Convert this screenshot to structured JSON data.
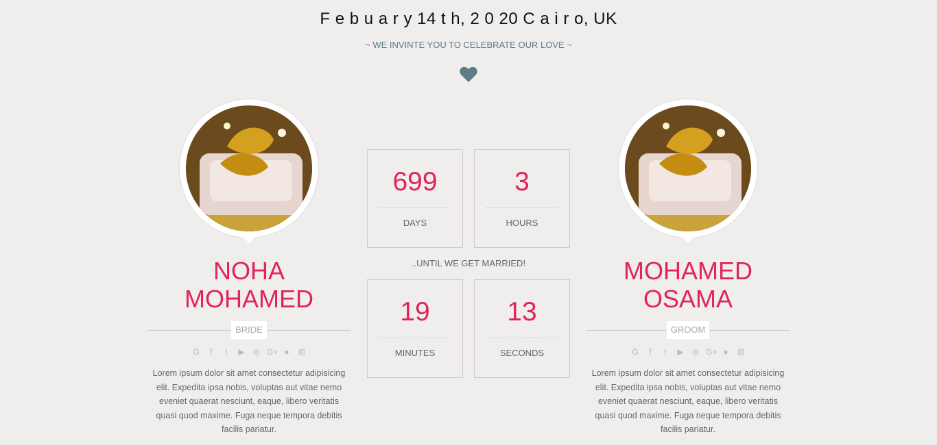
{
  "header": {
    "title": "F e b u a r y 14 t h, 2 0 20 C a i r o, UK",
    "subtitle": "~ WE INVINTE YOU TO CELEBRATE OUR LOVE ~",
    "heart_icon": "heart-icon",
    "heart_color": "#5e7b88"
  },
  "bride": {
    "name_line1": "NOHA",
    "name_line2": "MOHAMED",
    "role": "BRIDE",
    "bio": "Lorem ipsum dolor sit amet consectetur adipisicing elit. Expedita ipsa nobis, voluptas aut vitae nemo eveniet quaerat nesciunt, eaque, libero veritatis quasi quod maxime. Fuga neque tempora debitis facilis pariatur."
  },
  "groom": {
    "name_line1": "MOHAMED",
    "name_line2": "OSAMA",
    "role": "GROOM",
    "bio": "Lorem ipsum dolor sit amet consectetur adipisicing elit. Expedita ipsa nobis, voluptas aut vitae nemo eveniet quaerat nesciunt, eaque, libero veritatis quasi quod maxime. Fuga neque tempora debitis facilis pariatur."
  },
  "socials": [
    "google-icon",
    "facebook-icon",
    "twitter-icon",
    "youtube-icon",
    "instagram-icon",
    "google-plus-icon",
    "messenger-icon",
    "share-icon"
  ],
  "countdown": {
    "days": {
      "value": "699",
      "label": "DAYS"
    },
    "hours": {
      "value": "3",
      "label": "HOURS"
    },
    "minutes": {
      "value": "19",
      "label": "MINUTES"
    },
    "seconds": {
      "value": "13",
      "label": "SECONDS"
    },
    "until_text": "..UNTIL WE GET MARRIED!"
  },
  "colors": {
    "accent": "#e0245e",
    "background": "#f0eded",
    "muted": "#5e7b88"
  }
}
